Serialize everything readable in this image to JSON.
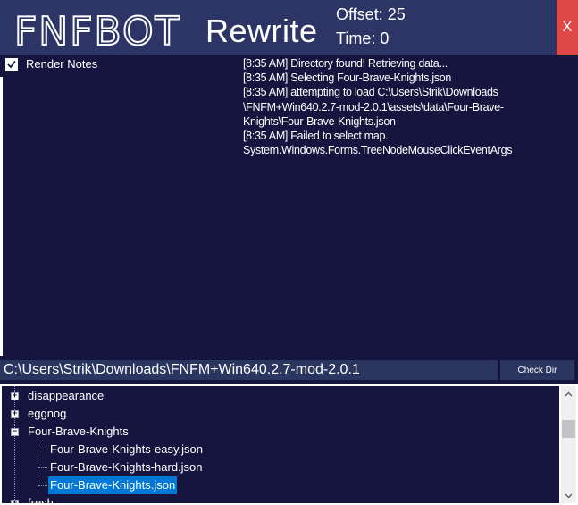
{
  "titlebar": {
    "logo_text": "FNFBOT",
    "title": "Rewrite",
    "offset": "Offset: 25",
    "time": "Time: 0",
    "close_label": "X"
  },
  "options": {
    "render_notes_label": "Render Notes",
    "render_notes_checked": true
  },
  "log": {
    "lines": [
      "[8:35 AM] Directory found! Retrieving data...",
      "[8:35 AM] Selecting Four-Brave-Knights.json",
      "[8:35 AM] attempting to load C:\\Users\\Strik\\Downloads\n\\FNFM+Win640.2.7-mod-2.0.1\\assets\\data\\Four-Brave-\nKnights\\Four-Brave-Knights.json",
      "[8:35 AM] Failed to select map.\nSystem.Windows.Forms.TreeNodeMouseClickEventArgs"
    ]
  },
  "directory": {
    "value": "C:\\Users\\Strik\\Downloads\\FNFM+Win640.2.7-mod-2.0.1",
    "check_button_label": "Check Dir"
  },
  "tree": {
    "nodes": [
      {
        "label": "disappearance",
        "expander": "+"
      },
      {
        "label": "eggnog",
        "expander": "+"
      },
      {
        "label": "Four-Brave-Knights",
        "expander": "−"
      },
      {
        "label": "Four-Brave-Knights-easy.json"
      },
      {
        "label": "Four-Brave-Knights-hard.json"
      },
      {
        "label": "Four-Brave-Knights.json",
        "selected": true
      },
      {
        "label": "fresh",
        "expander": "+"
      }
    ]
  },
  "colors": {
    "background": "#15153f",
    "titlebar": "#2c3566",
    "close": "#e04848",
    "selection": "#0078d7"
  }
}
